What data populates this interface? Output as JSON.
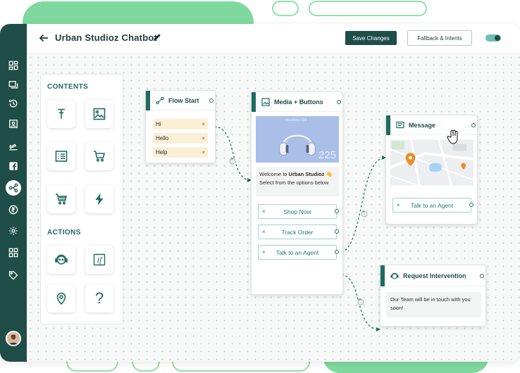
{
  "header": {
    "title": "Urban Studioz Chatbot",
    "save_label": "Save Changes",
    "fallback_label": "Fallback & Intents"
  },
  "sidebar": {
    "icons": [
      "dashboard-icon",
      "chat-icon",
      "history-icon",
      "contacts-icon",
      "campaign-icon",
      "facebook-icon",
      "flow-icon",
      "rupee-icon",
      "settings-icon",
      "apps-icon",
      "tag-icon"
    ],
    "active": "flow-icon"
  },
  "panel": {
    "contents_heading": "CONTENTS",
    "actions_heading": "ACTIONS",
    "content_tiles": [
      "text-icon",
      "image-icon",
      "list-icon",
      "cart-icon",
      "cart-icon",
      "lightning-icon"
    ],
    "action_tiles": [
      "intervention-icon",
      "condition-icon",
      "location-icon",
      "question-icon"
    ],
    "condition_glyph": "if",
    "question_glyph": "?"
  },
  "nodes": {
    "flow_start": {
      "title": "Flow Start",
      "keywords": [
        "Hi",
        "Hello",
        "Help"
      ]
    },
    "media_buttons": {
      "title": "Media + Buttons",
      "media_caption": "Headless 225",
      "media_number": "225",
      "welcome_prefix": "Welcome to ",
      "welcome_brand": "Urban Studioz",
      "welcome_emoji": "👋",
      "subtitle": "Select from the options below",
      "buttons": [
        "Shop Now",
        "Track Order",
        "Talk to an Agent"
      ]
    },
    "message": {
      "title": "Message",
      "button": "Talk to an Agent"
    },
    "request_intervention": {
      "title": "Request Intervention",
      "text": "Our Team will be in touch with you soon!"
    }
  },
  "remove_glyph": "×",
  "colors": {
    "brand_dark": "#1f4d47",
    "brand_accent": "#1f6b5f",
    "deco_green": "#7fd99e",
    "chip_bg": "#fbefd5",
    "pin_orange": "#f08a24"
  }
}
